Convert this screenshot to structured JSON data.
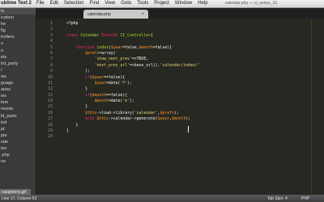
{
  "menubar": {
    "app": "ublime Text 2",
    "menus": [
      "File",
      "Edit",
      "Selection",
      "Find",
      "View",
      "Goto",
      "Tools",
      "Project",
      "Window",
      "Help"
    ],
    "title": "calendar.php — ci_series_16"
  },
  "sidebar": {
    "items": [
      "ts",
      "ication",
      "he",
      "fig",
      "trollers",
      "s",
      "e",
      "els",
      "ird_party",
      "/",
      "ws",
      "guage",
      "aries",
      "ws",
      "tem",
      "ments",
      "ld_parts",
      "ind",
      "pt",
      "pte",
      "nde",
      "ion",
      ".php",
      "",
      "ne"
    ],
    "selected_index": 0
  },
  "tab": {
    "label": "calendar.php",
    "close_glyph": "×"
  },
  "editor": {
    "lines": [
      {
        "n": "1",
        "tokens": [
          {
            "t": "<?php",
            "c": "plain"
          }
        ]
      },
      {
        "n": "2",
        "tokens": []
      },
      {
        "n": "3",
        "tokens": [
          {
            "t": "class ",
            "c": "kw"
          },
          {
            "t": "Calendar ",
            "c": "fn"
          },
          {
            "t": "Extends ",
            "c": "kw"
          },
          {
            "t": "CI_Controller",
            "c": "fn"
          },
          {
            "t": "{",
            "c": "plain"
          }
        ]
      },
      {
        "n": "4",
        "tokens": []
      },
      {
        "n": "5",
        "tokens": [
          {
            "t": "    function ",
            "c": "kw"
          },
          {
            "t": "index",
            "c": "fn"
          },
          {
            "t": "(",
            "c": "plain"
          },
          {
            "t": "$year",
            "c": "var"
          },
          {
            "t": "=false,",
            "c": "plain"
          },
          {
            "t": "$month",
            "c": "var"
          },
          {
            "t": "=false){",
            "c": "plain"
          }
        ]
      },
      {
        "n": "6",
        "tokens": [
          {
            "t": "        $prefs",
            "c": "var"
          },
          {
            "t": "=array(",
            "c": "plain"
          }
        ]
      },
      {
        "n": "7",
        "tokens": [
          {
            "t": "            'show_next_prev'",
            "c": "str"
          },
          {
            "t": "=>TRUE,",
            "c": "plain"
          }
        ]
      },
      {
        "n": "8",
        "tokens": [
          {
            "t": "            'next_prev_url'",
            "c": "str"
          },
          {
            "t": "=>base_url().",
            "c": "plain"
          },
          {
            "t": "'calendar/index/'",
            "c": "str"
          }
        ]
      },
      {
        "n": "9",
        "tokens": [
          {
            "t": "        );",
            "c": "plain"
          }
        ]
      },
      {
        "n": "10",
        "tokens": [
          {
            "t": "        if",
            "c": "kw"
          },
          {
            "t": "(",
            "c": "plain"
          },
          {
            "t": "$year",
            "c": "var"
          },
          {
            "t": "==false){",
            "c": "plain"
          }
        ]
      },
      {
        "n": "11",
        "tokens": [
          {
            "t": "            $year",
            "c": "var"
          },
          {
            "t": "=date(",
            "c": "plain"
          },
          {
            "t": "'Y'",
            "c": "str"
          },
          {
            "t": ");",
            "c": "plain"
          }
        ]
      },
      {
        "n": "12",
        "tokens": [
          {
            "t": "        }",
            "c": "plain"
          }
        ]
      },
      {
        "n": "13",
        "tokens": [
          {
            "t": "        if",
            "c": "kw"
          },
          {
            "t": "(",
            "c": "plain"
          },
          {
            "t": "$month",
            "c": "var"
          },
          {
            "t": "==false){",
            "c": "plain"
          }
        ]
      },
      {
        "n": "14",
        "tokens": [
          {
            "t": "            $month",
            "c": "var"
          },
          {
            "t": "=date(",
            "c": "plain"
          },
          {
            "t": "'m'",
            "c": "str"
          },
          {
            "t": ");",
            "c": "plain"
          }
        ]
      },
      {
        "n": "15",
        "tokens": [
          {
            "t": "        }",
            "c": "plain"
          }
        ]
      },
      {
        "n": "16",
        "tokens": [
          {
            "t": "        $this",
            "c": "var"
          },
          {
            "t": "->load->library(",
            "c": "plain"
          },
          {
            "t": "'calendar'",
            "c": "str"
          },
          {
            "t": ",",
            "c": "plain"
          },
          {
            "t": "$prefs",
            "c": "var"
          },
          {
            "t": ");",
            "c": "plain"
          }
        ]
      },
      {
        "n": "17",
        "tokens": [
          {
            "t": "        echo ",
            "c": "kw"
          },
          {
            "t": "$this",
            "c": "var"
          },
          {
            "t": "->calendar->generate(",
            "c": "plain"
          },
          {
            "t": "$year",
            "c": "var"
          },
          {
            "t": ",",
            "c": "plain"
          },
          {
            "t": "$month",
            "c": "var"
          },
          {
            "t": ");",
            "c": "plain"
          }
        ]
      },
      {
        "n": "18",
        "tokens": [
          {
            "t": "    }",
            "c": "plain"
          }
        ]
      },
      {
        "n": "19",
        "tokens": [
          {
            "t": "}",
            "c": "plain"
          }
        ]
      },
      {
        "n": "20",
        "tokens": []
      }
    ]
  },
  "taskbar": {
    "label": "raspberry.gif"
  },
  "statusbar": {
    "position": "Line 17, Column 52",
    "tab_size": "Tab Size: 4",
    "syntax": "PHP"
  }
}
